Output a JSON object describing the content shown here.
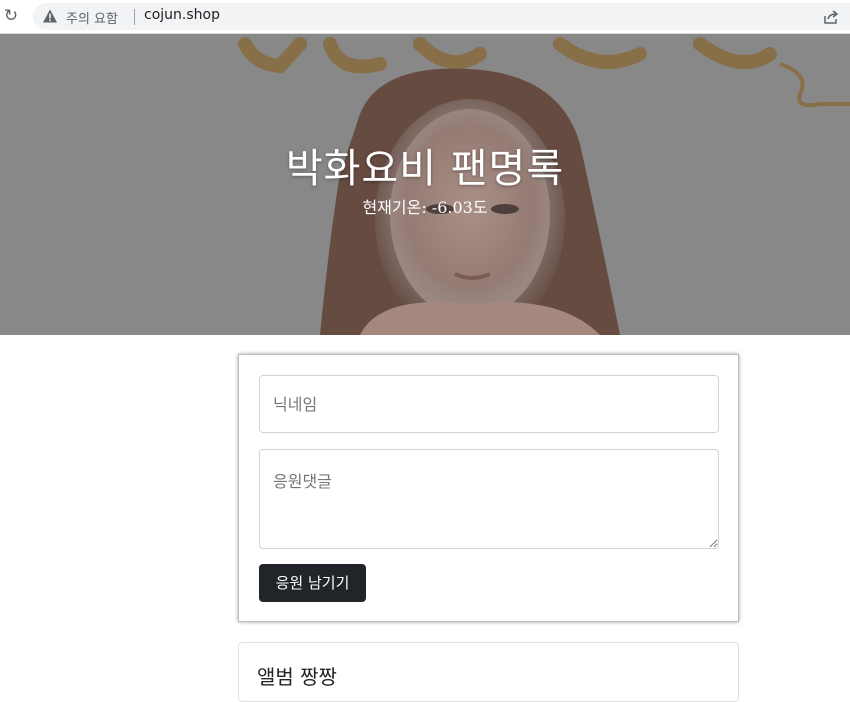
{
  "browser": {
    "security_warning": "주의 요함",
    "url": "cojun.shop",
    "icons": [
      "reload-icon",
      "warning-icon",
      "share-icon"
    ]
  },
  "hero": {
    "title": "박화요비 팬명록",
    "weather": "현재기온: -6.03도",
    "overlay_color": "#808080"
  },
  "form": {
    "nickname_placeholder": "닉네임",
    "comment_placeholder": "응원댓글",
    "submit_label": "응원 남기기",
    "button_color": "#212529"
  },
  "album": {
    "title": "앨범 짱짱"
  }
}
